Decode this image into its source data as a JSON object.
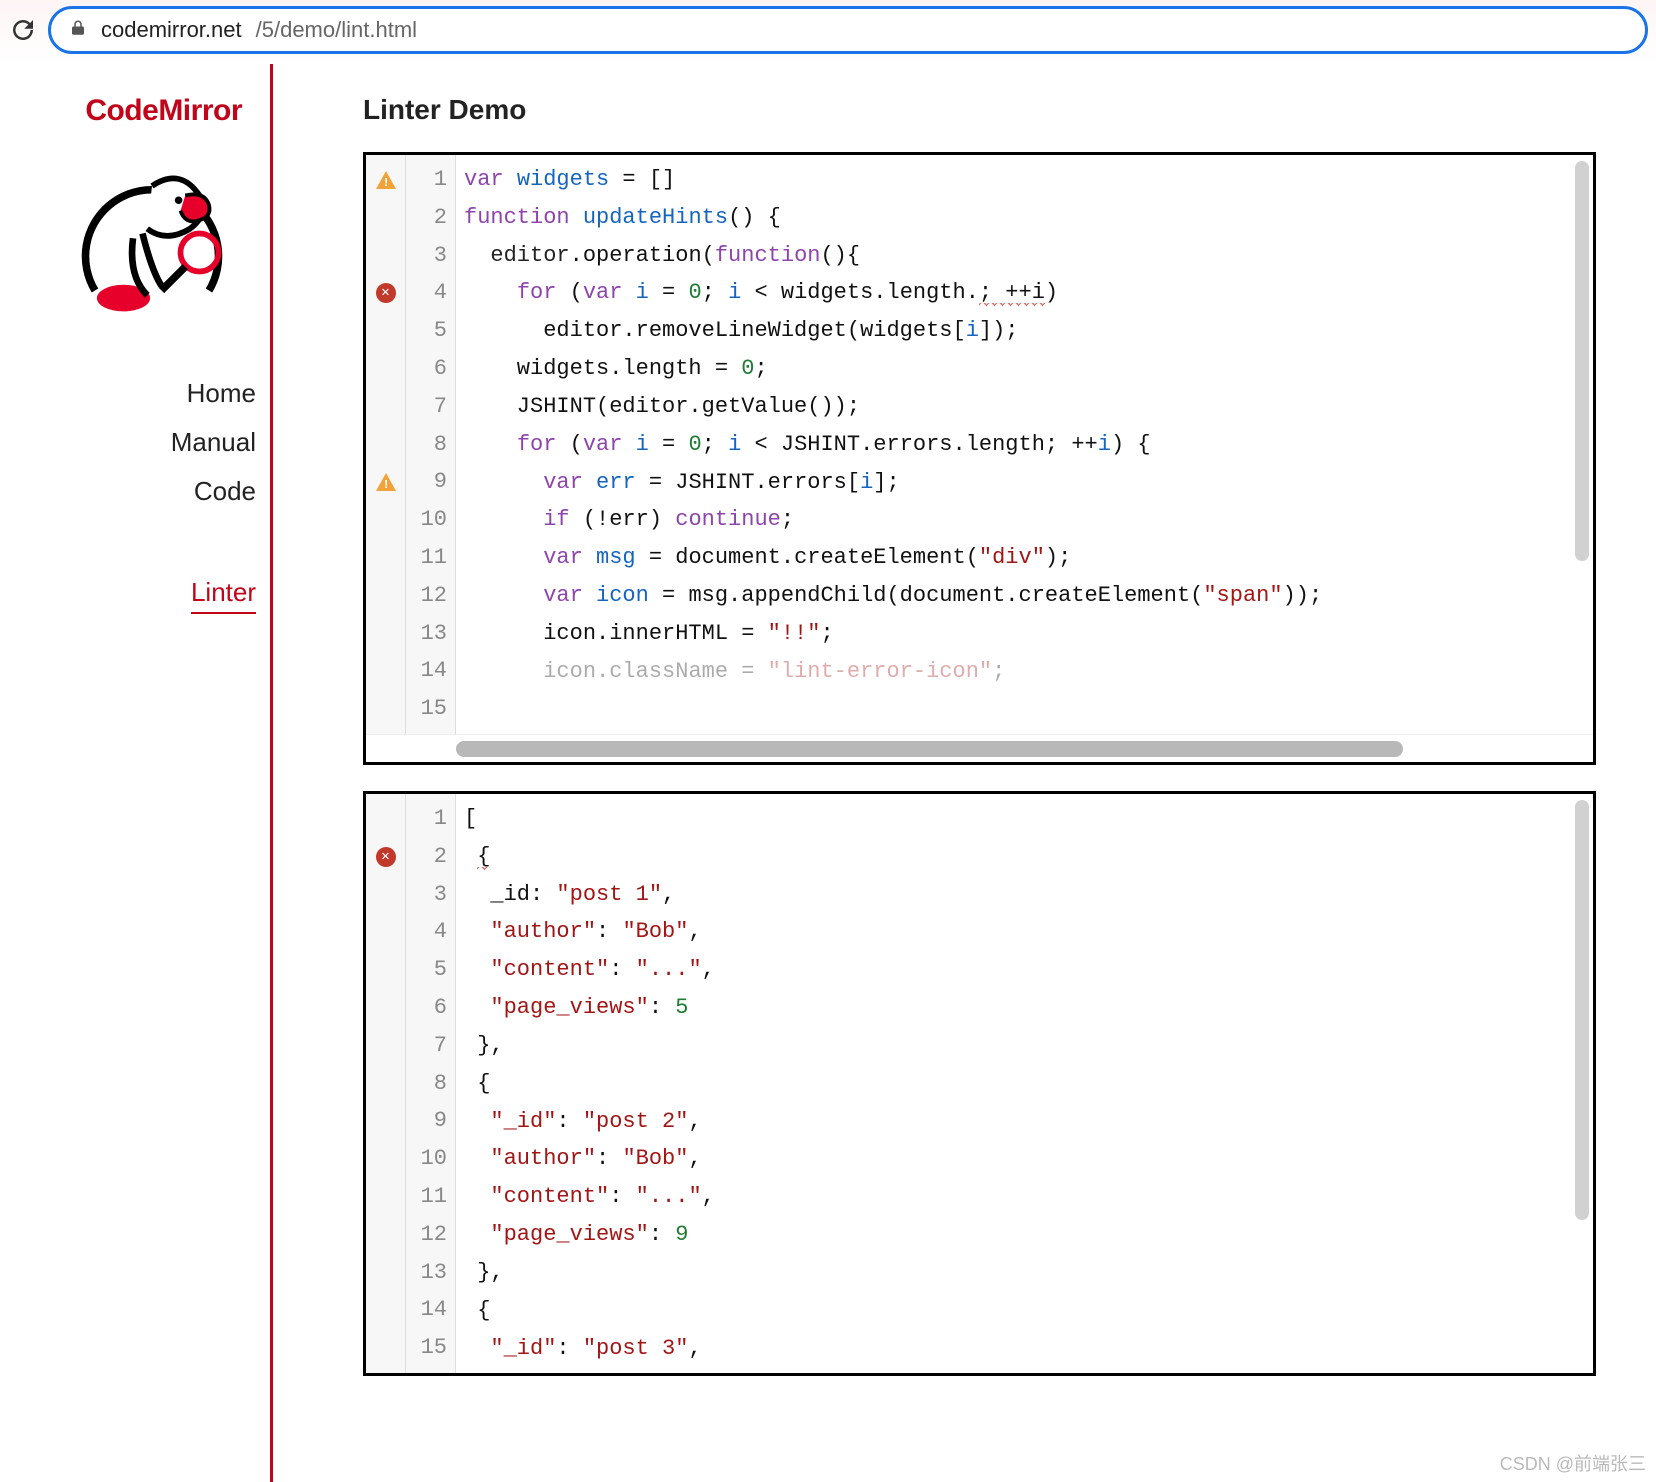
{
  "browser": {
    "url_host": "codemirror.net",
    "url_path": "/5/demo/lint.html"
  },
  "sidebar": {
    "brand": "CodeMirror",
    "nav": {
      "home": "Home",
      "manual": "Manual",
      "code": "Code",
      "linter": "Linter"
    }
  },
  "main": {
    "title": "Linter Demo"
  },
  "editor1": {
    "line_count": 15,
    "marks": {
      "1": "warn",
      "4": "error",
      "9": "warn"
    },
    "lines_raw": [
      "var widgets = []",
      "function updateHints() {",
      "  editor.operation(function(){",
      "    for (var i = 0; i < widgets.length.; ++i)",
      "      editor.removeLineWidget(widgets[i]);",
      "    widgets.length = 0;",
      "",
      "    JSHINT(editor.getValue());",
      "    for (var i = 0; i < JSHINT.errors.length; ++i) {",
      "      var err = JSHINT.errors[i];",
      "      if (!err) continue;",
      "      var msg = document.createElement(\"div\");",
      "      var icon = msg.appendChild(document.createElement(\"span\"));",
      "      icon.innerHTML = \"!!\";",
      "      icon.className = \"lint-error-icon\";"
    ],
    "lines_html": [
      "<span class='kw'>var</span> <span class='def'>widgets</span> = []",
      "<span class='kw'>function</span> <span class='def'>updateHints</span>() {",
      "  <span class='prop'>editor</span>.operation(<span class='kw'>function</span>(){",
      "    <span class='kw'>for</span> (<span class='kw'>var</span> <span class='def'>i</span> = <span class='num'>0</span>; <span class='def'>i</span> &lt; widgets.length.<span class='squiggle'>; ++i</span>)",
      "      editor.removeLineWidget(widgets[<span class='def'>i</span>]);",
      "    widgets.length = <span class='num'>0</span>;",
      "",
      "    JSHINT(editor.getValue());",
      "    <span class='kw'>for</span> (<span class='kw'>var</span> <span class='def'>i</span> = <span class='num'>0</span>; <span class='def'>i</span> &lt; JSHINT.errors.length; ++<span class='def'>i</span>) {",
      "      <span class='kw'>var</span> <span class='def'>err</span> = JSHINT.errors[<span class='def'>i</span>];",
      "      <span class='kw'>if</span> (!err) <span class='kw'>continue</span>;",
      "      <span class='kw'>var</span> <span class='def'>msg</span> = document.createElement(<span class='str'>\"div\"</span>);",
      "      <span class='kw'>var</span> <span class='def'>icon</span> = msg.appendChild(document.createElement(<span class='str'>\"span\"</span>));",
      "      icon.innerHTML = <span class='str'>\"!!\"</span>;",
      "      <span style='opacity:.35'>icon.className = </span><span class='str' style='opacity:.35'>\"lint-error-icon\"</span><span style='opacity:.35'>;</span>"
    ]
  },
  "editor2": {
    "line_count": 15,
    "marks": {
      "2": "error"
    },
    "lines_raw": [
      "[",
      " {",
      "  _id: \"post 1\",",
      "  \"author\": \"Bob\",",
      "  \"content\": \"...\",",
      "  \"page_views\": 5",
      " },",
      " {",
      "  \"_id\": \"post 2\",",
      "  \"author\": \"Bob\",",
      "  \"content\": \"...\",",
      "  \"page_views\": 9",
      " },",
      " {",
      "  \"_id\": \"post 3\","
    ],
    "lines_html": [
      "[",
      " <span class='squiggle'>{</span>",
      "  _id: <span class='str'>\"post 1\"</span>,",
      "  <span class='str'>\"author\"</span>: <span class='str'>\"Bob\"</span>,",
      "  <span class='str'>\"content\"</span>: <span class='str'>\"...\"</span>,",
      "  <span class='str'>\"page_views\"</span>: <span class='num'>5</span>",
      " },",
      " {",
      "  <span class='str'>\"_id\"</span>: <span class='str'>\"post 2\"</span>,",
      "  <span class='str'>\"author\"</span>: <span class='str'>\"Bob\"</span>,",
      "  <span class='str'>\"content\"</span>: <span class='str'>\"...\"</span>,",
      "  <span class='str'>\"page_views\"</span>: <span class='num'>9</span>",
      " },",
      " {",
      "  <span class='str'>\"_id\"</span>: <span class='str'>\"post 3\"</span>,"
    ]
  },
  "watermark": "CSDN @前端张三"
}
